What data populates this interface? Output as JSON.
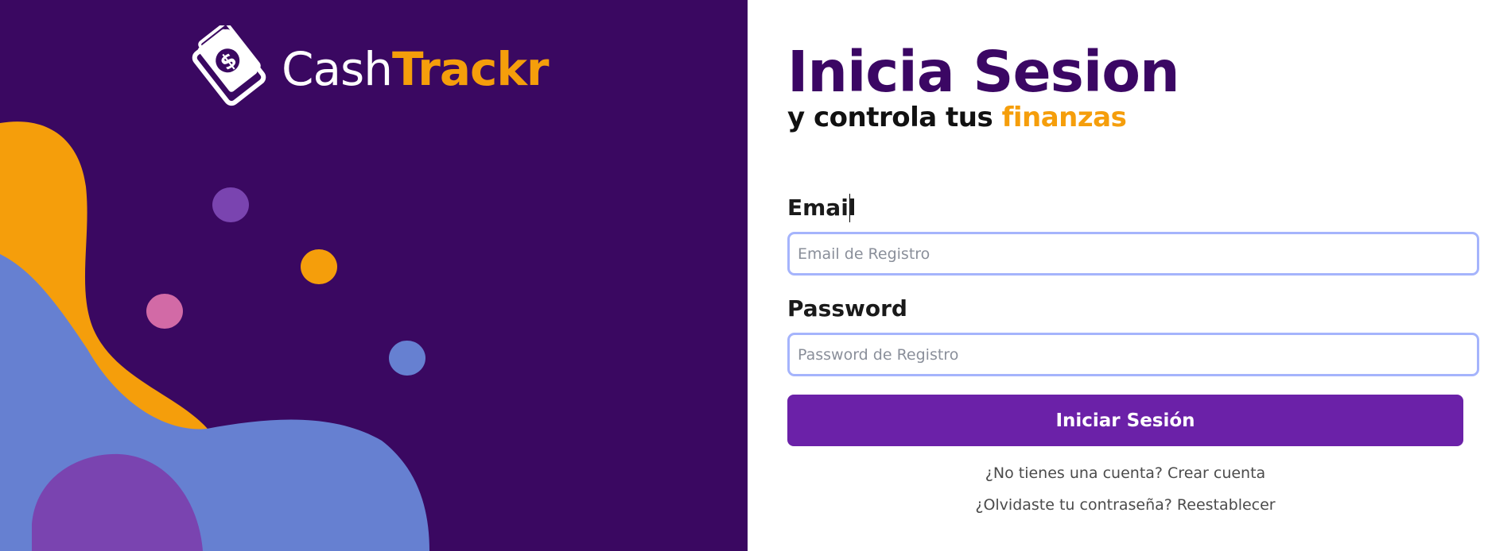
{
  "brand": {
    "name_part1": "Cash",
    "name_part2": "Trackr",
    "logo_icon": "money-wallet-icon",
    "accent_color": "#f59e0b",
    "primary_color": "#3b0764",
    "button_color": "#6b21a8"
  },
  "login": {
    "title": "Inicia Sesion",
    "subtitle_prefix": "y controla tus ",
    "subtitle_accent": "finanzas",
    "email_label": "Email",
    "email_placeholder": "Email de Registro",
    "email_value": "",
    "password_label": "Password",
    "password_placeholder": "Password de Registro",
    "password_value": "",
    "submit_label": "Iniciar Sesión",
    "register_link": "¿No tienes una cuenta? Crear cuenta",
    "forgot_link": "¿Olvidaste tu contraseña? Reestablecer"
  }
}
